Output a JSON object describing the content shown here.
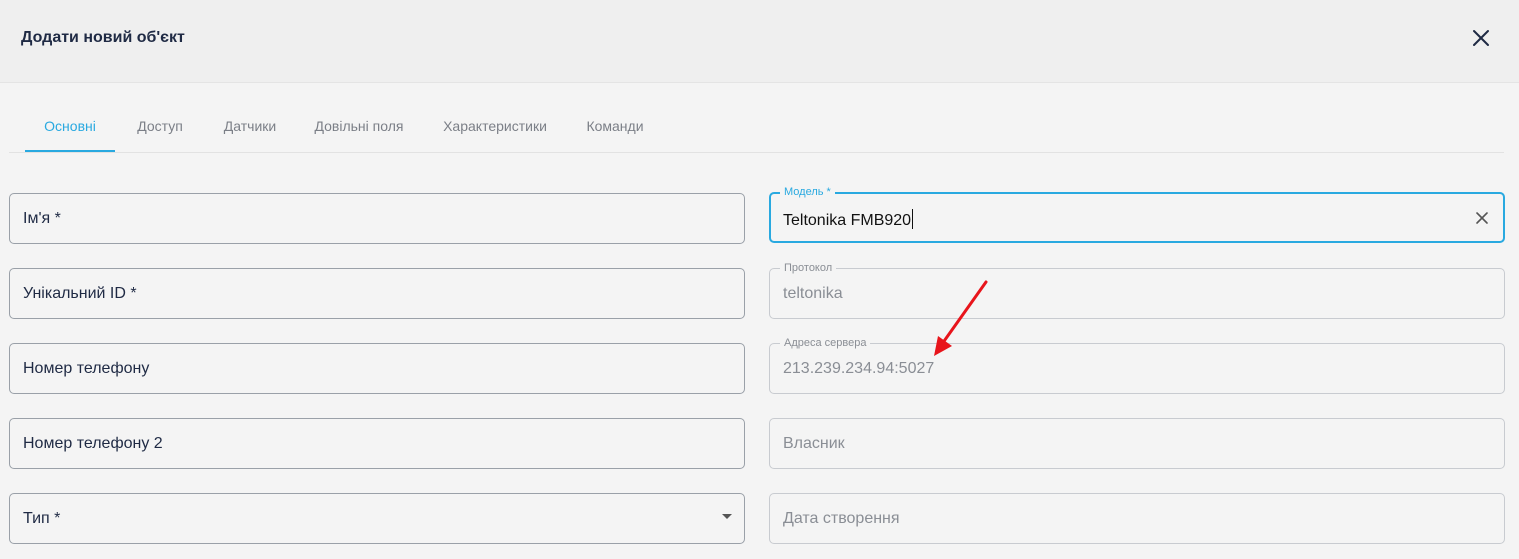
{
  "dialog": {
    "title": "Додати новий об'єкт",
    "close_icon": "close-icon"
  },
  "tabs": [
    {
      "label": "Основні",
      "active": true
    },
    {
      "label": "Доступ",
      "active": false
    },
    {
      "label": "Датчики",
      "active": false
    },
    {
      "label": "Довільні поля",
      "active": false
    },
    {
      "label": "Характеристики",
      "active": false
    },
    {
      "label": "Команди",
      "active": false
    }
  ],
  "left_fields": {
    "name": {
      "placeholder": "Ім'я *",
      "value": ""
    },
    "unique_id": {
      "placeholder": "Унікальний ID *",
      "value": ""
    },
    "phone": {
      "placeholder": "Номер телефону",
      "value": ""
    },
    "phone2": {
      "placeholder": "Номер телефону 2",
      "value": ""
    },
    "type": {
      "placeholder": "Тип *",
      "value": "",
      "icon": "dropdown-arrow-icon"
    }
  },
  "right_fields": {
    "model": {
      "label": "Модель *",
      "value": "Teltonika FMB920",
      "icon": "clear-icon"
    },
    "protocol": {
      "label": "Протокол",
      "value": "teltonika"
    },
    "server_address": {
      "label": "Адреса сервера",
      "value": "213.239.234.94:5027"
    },
    "owner": {
      "placeholder": "Власник",
      "value": ""
    },
    "created_date": {
      "placeholder": "Дата створення",
      "value": ""
    }
  },
  "colors": {
    "accent": "#29a9e0",
    "annotation_arrow": "#e8141b",
    "text": "#1f2a44",
    "muted": "#8a8e95"
  },
  "annotation": {
    "icon": "red-arrow-annotation"
  }
}
